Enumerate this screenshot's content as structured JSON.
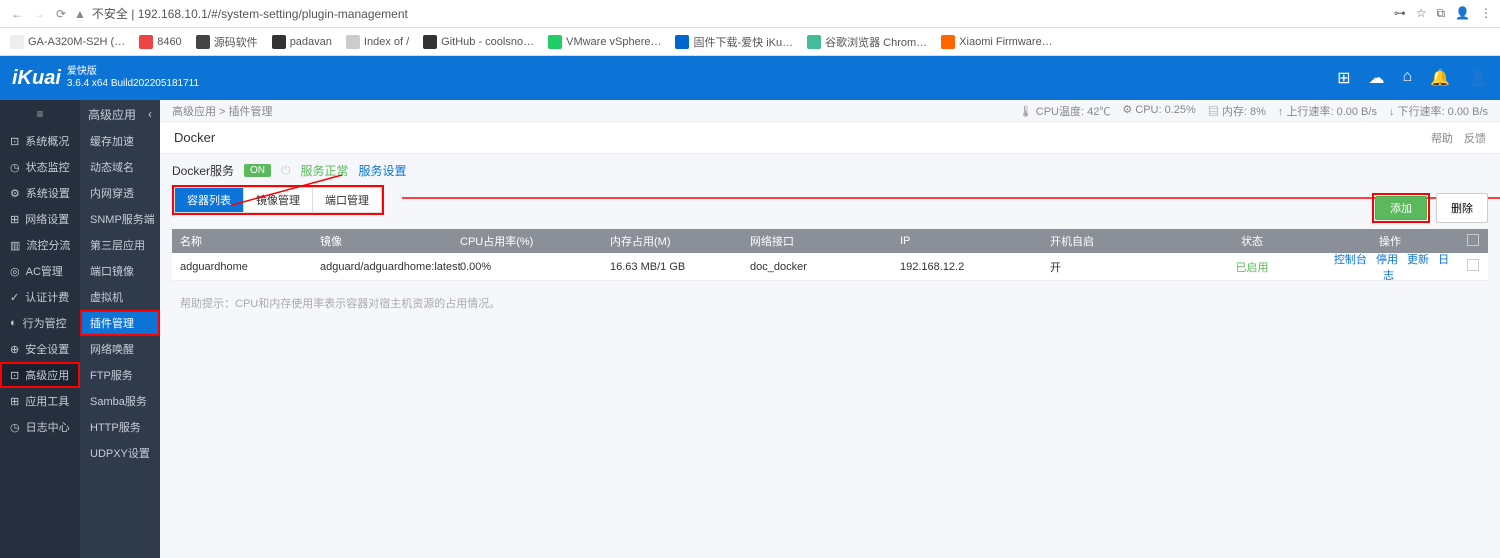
{
  "browser": {
    "url_prefix": "不安全 |",
    "url": "192.168.10.1/#/system-setting/plugin-management",
    "bookmarks": [
      "GA-A320M-S2H (…",
      "8460",
      "源码软件",
      "padavan",
      "Index of /",
      "GitHub - coolsno…",
      "VMware vSphere…",
      "固件下载-爱快 iKu…",
      "谷歌浏览器 Chrom…",
      "Xiaomi Firmware…"
    ]
  },
  "header": {
    "logo": "iKuai",
    "edition": "爱快版",
    "build": "3.6.4 x64 Build202205181711"
  },
  "sidebar1": {
    "items": [
      "系统概况",
      "状态监控",
      "系统设置",
      "网络设置",
      "流控分流",
      "AC管理",
      "认证计费",
      "行为管控",
      "安全设置",
      "高级应用",
      "应用工具",
      "日志中心"
    ],
    "active": "高级应用"
  },
  "sidebar2": {
    "title": "高级应用",
    "items": [
      "缓存加速",
      "动态域名",
      "内网穿透",
      "SNMP服务端",
      "第三层应用",
      "端口镜像",
      "虚拟机",
      "插件管理",
      "网络唤醒",
      "FTP服务",
      "Samba服务",
      "HTTP服务",
      "UDPXY设置"
    ],
    "active": "插件管理"
  },
  "statusbar": {
    "breadcrumb": "高级应用 > 插件管理",
    "cpu_temp_label": "CPU温度:",
    "cpu_temp": "42℃",
    "cpu_label": "CPU:",
    "cpu": "0.25%",
    "mem_label": "内存:",
    "mem": "8%",
    "up_label": "上行速率:",
    "up": "0.00 B/s",
    "down_label": "下行速率:",
    "down": "0.00 B/s"
  },
  "page": {
    "title": "Docker",
    "help": "帮助",
    "feedback": "反馈"
  },
  "service": {
    "label": "Docker服务",
    "switch": "ON",
    "status": "服务正常",
    "config": "服务设置"
  },
  "tabs": [
    "容器列表",
    "镜像管理",
    "端口管理"
  ],
  "actions": {
    "add": "添加",
    "del": "删除"
  },
  "table": {
    "headers": {
      "name": "名称",
      "img": "镜像",
      "cpu": "CPU占用率(%)",
      "mem": "内存占用(M)",
      "net": "网络接口",
      "ip": "IP",
      "boot": "开机自启",
      "stat": "状态",
      "op": "操作"
    },
    "row": {
      "name": "adguardhome",
      "img": "adguard/adguardhome:latest",
      "cpu": "0.00%",
      "mem": "16.63 MB/1 GB",
      "net": "doc_docker",
      "ip": "192.168.12.2",
      "boot": "开",
      "stat": "已启用",
      "ops": [
        "控制台",
        "停用",
        "更新",
        "日志"
      ]
    }
  },
  "hint": "帮助提示：CPU和内存使用率表示容器对宿主机资源的占用情况。"
}
